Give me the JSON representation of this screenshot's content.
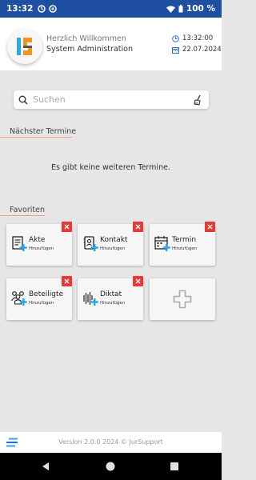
{
  "status_bar": {
    "time": "13:32",
    "battery": "100 %"
  },
  "header": {
    "greeting": "Herzlich Willkommen",
    "user": "System Administration",
    "time": "13:32:00",
    "date": "22.07.2024"
  },
  "search": {
    "placeholder": "Suchen"
  },
  "termine": {
    "title": "Nächster Termine",
    "empty_message": "Es gibt keine weiteren Termine."
  },
  "favoriten": {
    "title": "Favoriten",
    "tiles": [
      {
        "label": "Akte",
        "sub": "Hinzufügen",
        "icon": "document-add-icon"
      },
      {
        "label": "Kontakt",
        "sub": "Hinzufügen",
        "icon": "contact-book-add-icon"
      },
      {
        "label": "Termin",
        "sub": "Hinzufügen",
        "icon": "calendar-add-icon"
      },
      {
        "label": "Beteiligte",
        "sub": "Hinzufügen",
        "icon": "people-add-icon"
      },
      {
        "label": "Diktat",
        "sub": "Hinzufügen",
        "icon": "audio-wave-add-icon"
      }
    ]
  },
  "footer": {
    "version": "Version 2.0.0 2024 © JurSupport"
  },
  "colors": {
    "status_bar": "#1e4fa0",
    "accent_blue": "#2aa7e8",
    "delete_red": "#e53935",
    "section_line": "#f0a080"
  }
}
